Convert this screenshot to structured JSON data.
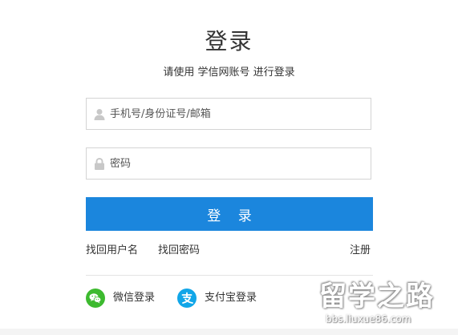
{
  "login": {
    "title": "登录",
    "subtitle": "请使用 学信网账号 进行登录",
    "username_placeholder": "手机号/身份证号/邮箱",
    "password_placeholder": "密码",
    "submit_label": "登 录",
    "username_icon": "user-icon",
    "password_icon": "lock-icon"
  },
  "links": {
    "recover_username": "找回用户名",
    "recover_password": "找回密码",
    "register": "注册"
  },
  "social": {
    "wechat_label": "微信登录",
    "alipay_label": "支付宝登录",
    "wechat_icon": "wechat-icon",
    "alipay_icon": "alipay-icon"
  },
  "watermark": {
    "main": "留学之路",
    "sub": "bbs.liuxue86.com"
  },
  "colors": {
    "primary_button": "#1b86dd",
    "wechat": "#3dba2f",
    "alipay": "#11a6e8",
    "field_border": "#d4d4d4"
  }
}
